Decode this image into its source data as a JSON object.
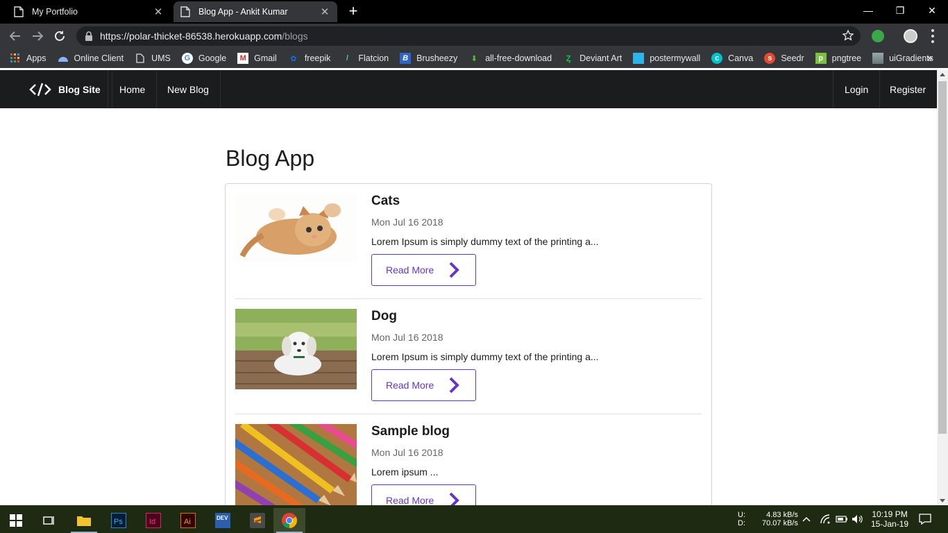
{
  "browser": {
    "tabs": [
      {
        "title": "My Portfolio",
        "active": false
      },
      {
        "title": "Blog App - Ankit Kumar",
        "active": true
      }
    ],
    "url_host": "https://polar-thicket-86538.herokuapp.com",
    "url_path": "/blogs",
    "bookmarks": [
      {
        "label": "Apps",
        "icon": "apps-grid-icon"
      },
      {
        "label": "Online Client",
        "icon": "online-client-icon"
      },
      {
        "label": "UMS",
        "icon": "page-icon"
      },
      {
        "label": "Google",
        "icon": "google-icon"
      },
      {
        "label": "Gmail",
        "icon": "gmail-icon"
      },
      {
        "label": "freepik",
        "icon": "freepik-icon"
      },
      {
        "label": "Flatcion",
        "icon": "flaticon-icon"
      },
      {
        "label": "Brusheezy",
        "icon": "brusheezy-icon"
      },
      {
        "label": "all-free-download",
        "icon": "download-arrow-icon"
      },
      {
        "label": "Deviant Art",
        "icon": "deviantart-icon"
      },
      {
        "label": "postermywall",
        "icon": "postermywall-icon"
      },
      {
        "label": "Canva",
        "icon": "canva-icon"
      },
      {
        "label": "Seedr",
        "icon": "seedr-icon"
      },
      {
        "label": "pngtree",
        "icon": "pngtree-icon"
      },
      {
        "label": "uiGradients",
        "icon": "uigradients-icon"
      }
    ],
    "bookmarks_more": "»"
  },
  "site": {
    "brand": "Blog Site",
    "nav": {
      "home": "Home",
      "new_blog": "New Blog",
      "login": "Login",
      "register": "Register"
    },
    "page_title": "Blog App",
    "read_more_label": "Read More",
    "posts": [
      {
        "title": "Cats",
        "date": "Mon Jul 16 2018",
        "excerpt": "Lorem Ipsum is simply dummy text of the printing a...",
        "image": "kitten-photo"
      },
      {
        "title": "Dog",
        "date": "Mon Jul 16 2018",
        "excerpt": "Lorem Ipsum is simply dummy text of the printing a...",
        "image": "puppy-photo"
      },
      {
        "title": "Sample blog",
        "date": "Mon Jul 16 2018",
        "excerpt": "Lorem ipsum ...",
        "image": "colored-pencils-photo"
      }
    ],
    "accent_color": "#6435c9",
    "nav_color": "#1b1c1d"
  },
  "taskbar": {
    "upload_label": "U:",
    "download_label": "D:",
    "upload_speed": "4.83 kB/s",
    "download_speed": "70.07 kB/s",
    "time": "10:19 PM",
    "date": "15-Jan-19"
  }
}
